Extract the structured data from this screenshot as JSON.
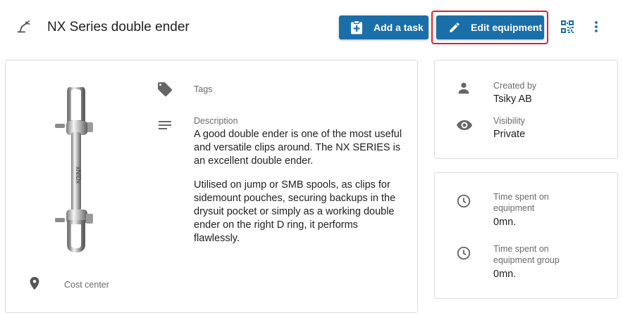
{
  "header": {
    "title": "NX Series double ender",
    "add_task_label": "Add a task",
    "edit_equipment_label": "Edit equipment",
    "icons": [
      "equipment-icon",
      "clipboard-plus-icon",
      "pencil-icon",
      "qr-code-icon",
      "more-vert-icon"
    ]
  },
  "colors": {
    "primary_button": "#1a6fa8",
    "highlight_border": "#e0212b",
    "icon_gray": "#666666"
  },
  "details": {
    "tags_label": "Tags",
    "description_label": "Description",
    "description_paragraphs": [
      "A good double ender is one of the most useful and versatile clips around. The NX SERIES is an excellent double ender.",
      "Utilised on jump or SMB spools, as clips for sidemount pouches, securing backups in the drysuit pocket or simply as a working double ender on the right D ring, it performs flawlessly."
    ],
    "cost_center_label": "Cost center"
  },
  "meta": {
    "created_by_label": "Created by",
    "created_by_value": "Tsiky AB",
    "visibility_label": "Visibility",
    "visibility_value": "Private"
  },
  "time": {
    "equipment_label_line1": "Time spent on",
    "equipment_label_line2": "equipment",
    "equipment_value": "0mn.",
    "group_label_line1": "Time spent on",
    "group_label_line2": "equipment group",
    "group_value": "0mn."
  }
}
